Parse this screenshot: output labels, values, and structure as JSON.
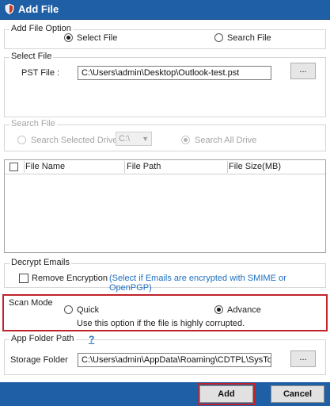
{
  "window": {
    "title": "Add File"
  },
  "add_file_option": {
    "label": "Add File Option",
    "select_file": "Select File",
    "search_file": "Search File",
    "selected": "select_file"
  },
  "select_file": {
    "label": "Select File",
    "pst_label": "PST File :",
    "pst_value": "C:\\Users\\admin\\Desktop\\Outlook-test.pst",
    "browse_label": "..."
  },
  "search_file": {
    "label": "Search File",
    "selected_drive": "Search Selected Drive",
    "drive_value": "C:\\",
    "all_drive": "Search All Drive"
  },
  "file_table": {
    "columns": [
      "File Name",
      "File Path",
      "File Size(MB)"
    ],
    "rows": []
  },
  "decrypt": {
    "label": "Decrypt Emails",
    "remove_encryption": "Remove Encryption",
    "hint": "(Select if Emails are encrypted with SMIME or OpenPGP)"
  },
  "scan_mode": {
    "label": "Scan Mode",
    "quick": "Quick",
    "advance": "Advance",
    "selected": "advance",
    "note": "Use this option if the file is highly corrupted."
  },
  "app_folder": {
    "label": "App Folder Path",
    "help": "?",
    "storage_label": "Storage Folder",
    "storage_value": "C:\\Users\\admin\\AppData\\Roaming\\CDTPL\\SysTools C",
    "browse_label": "..."
  },
  "footer": {
    "add_label": "Add",
    "cancel_label": "Cancel"
  },
  "colors": {
    "titlebar": "#1f5fa6",
    "highlight": "#c0242b",
    "link": "#1e6fc2"
  }
}
